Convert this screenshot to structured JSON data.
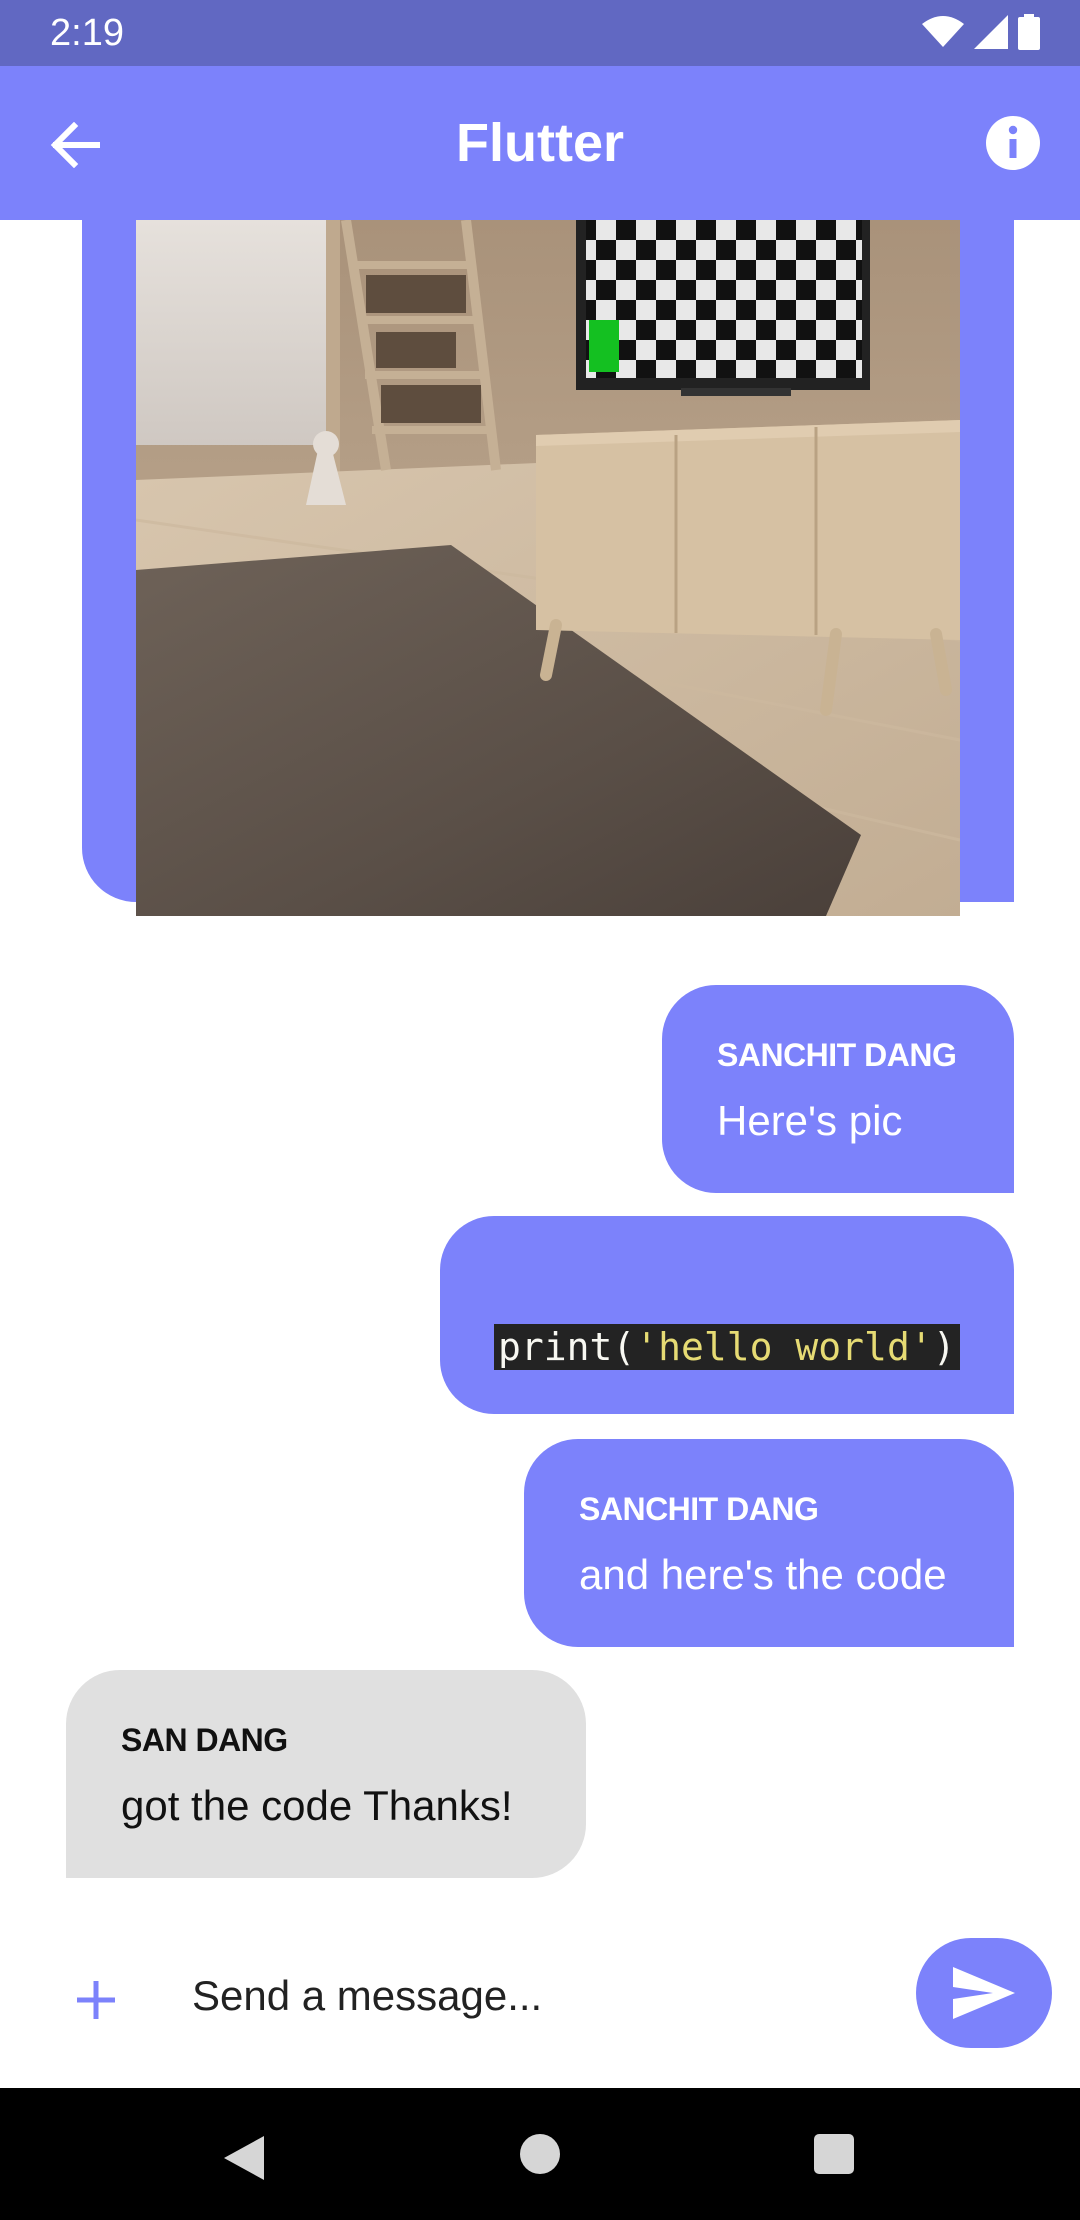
{
  "status_bar": {
    "time": "2:19"
  },
  "app_bar": {
    "title": "Flutter"
  },
  "messages": [
    {
      "sender": "SANCHIT DANG",
      "text": "Here's pic"
    },
    {
      "code": {
        "fn": "print(",
        "arg": "'hello world'",
        "close": ")"
      }
    },
    {
      "sender": "SANCHIT DANG",
      "text": "and here's the code"
    },
    {
      "sender": "SAN DANG",
      "text": "got the code Thanks!"
    }
  ],
  "composer": {
    "placeholder": "Send a message..."
  },
  "colors": {
    "accent": "#7c82fb",
    "status_bar": "#6168c2",
    "incoming_bubble": "#e0e0e0",
    "code_bg": "#232323",
    "code_string": "#e6db74"
  },
  "icons": [
    "back-arrow-icon",
    "info-icon",
    "plus-icon",
    "send-icon",
    "wifi-icon",
    "signal-icon",
    "battery-icon"
  ]
}
